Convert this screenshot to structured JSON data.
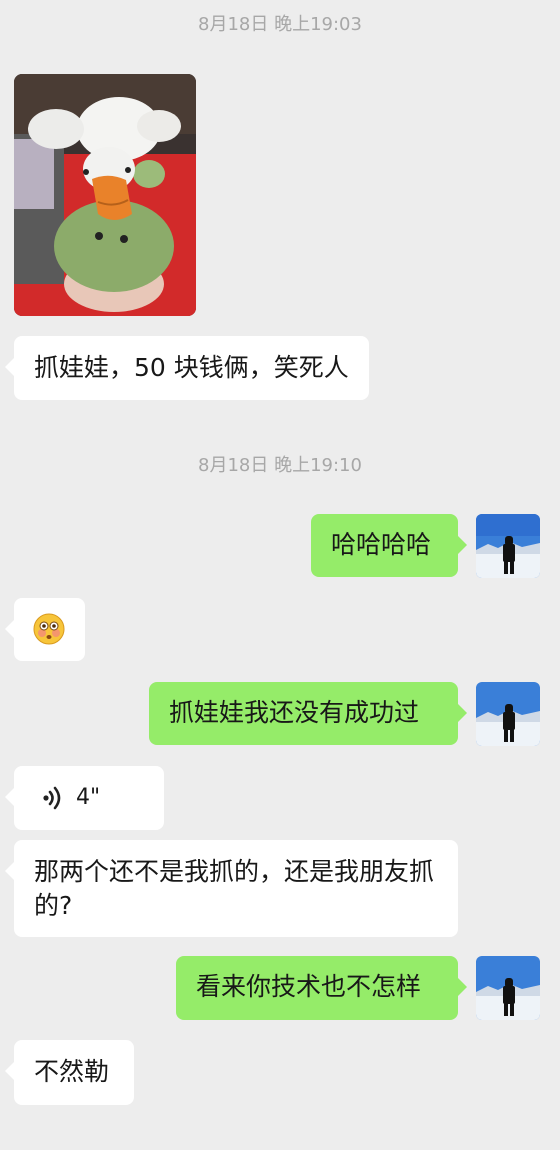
{
  "chat": {
    "timestamp1": "8月18日 晚上19:03",
    "timestamp2": "8月18日 晚上19:10",
    "msg_caption": "抓娃娃，50 块钱俩，笑死人",
    "msg_haha": "哈哈哈哈",
    "msg_never": "抓娃娃我还没有成功过",
    "voice_duration": "4\"",
    "msg_not_me": "那两个还不是我抓的，还是我朋友抓的?",
    "msg_skill": "看来你技术也不怎样",
    "msg_otherwise": "不然勒"
  },
  "icons": {
    "emoji": "flushed-face-emoji",
    "voice": "voice-wave-icon",
    "avatar": "snow-mountain-avatar",
    "photo": "duck-frog-plush-photo"
  },
  "colors": {
    "background": "#ededed",
    "self_bubble": "#95ec69",
    "other_bubble": "#ffffff",
    "timestamp": "#a7a7a7"
  }
}
